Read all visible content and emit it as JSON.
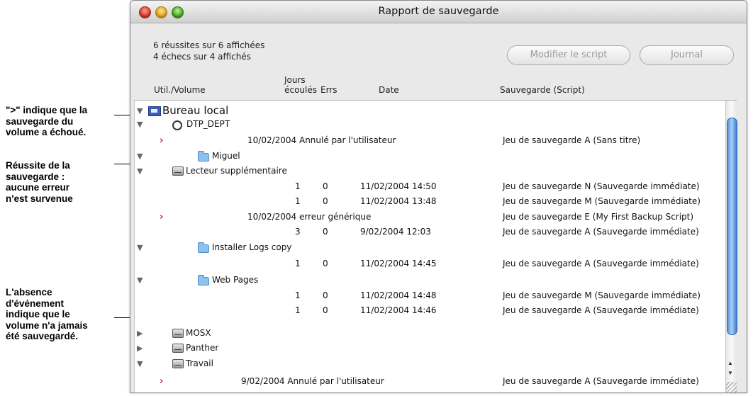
{
  "window": {
    "title": "Rapport de sauvegarde",
    "success_stat": "6 réussites sur 6 affichées",
    "failure_stat": "4 échecs sur 4 affichés",
    "edit_script_button": "Modifier le script",
    "log_button": "Journal"
  },
  "columns": {
    "user_volume": "Util./Volume",
    "days_line1": "Jours",
    "days_line2": "écoulés",
    "errors": "Errs",
    "date": "Date",
    "backup": "Sauvegarde (Script)"
  },
  "rows": [
    {
      "name": "Bureau local"
    },
    {
      "name": "DTP_DEPT"
    },
    {
      "marker": "›",
      "date_text": "10/02/2004 Annulé par l'utilisateur",
      "backup": "Jeu de sauvegarde A (Sans titre)"
    },
    {
      "name": "Miguel"
    },
    {
      "name": "Lecteur supplémentaire"
    },
    {
      "days": "1",
      "errs": "0",
      "date": "11/02/2004 14:50",
      "backup": "Jeu de sauvegarde N (Sauvegarde immédiate)"
    },
    {
      "days": "1",
      "errs": "0",
      "date": "11/02/2004 13:48",
      "backup": "Jeu de sauvegarde M (Sauvegarde immédiate)"
    },
    {
      "marker": "›",
      "date_text": "10/02/2004 erreur générique",
      "backup": "Jeu de sauvegarde E (My First Backup Script)"
    },
    {
      "days": "3",
      "errs": "0",
      "date": "9/02/2004 12:03",
      "backup": "Jeu de sauvegarde A (Sauvegarde immédiate)"
    },
    {
      "name": "Installer Logs copy"
    },
    {
      "days": "1",
      "errs": "0",
      "date": "11/02/2004 14:45",
      "backup": "Jeu de sauvegarde A (Sauvegarde immédiate)"
    },
    {
      "name": "Web Pages"
    },
    {
      "days": "1",
      "errs": "0",
      "date": "11/02/2004 14:48",
      "backup": "Jeu de sauvegarde M (Sauvegarde immédiate)"
    },
    {
      "days": "1",
      "errs": "0",
      "date": "11/02/2004 14:46",
      "backup": "Jeu de sauvegarde A (Sauvegarde immédiate)"
    },
    {
      "name": "MOSX"
    },
    {
      "name": "Panther"
    },
    {
      "name": "Travail"
    },
    {
      "marker": "›",
      "date_text": "9/02/2004 Annulé par l'utilisateur",
      "backup": "Jeu de sauvegarde A (Sauvegarde immédiate)"
    }
  ],
  "tree_icons": {
    "expanded": "▼",
    "collapsed": "▶"
  },
  "callouts": {
    "failed": [
      "\">\" indique que la",
      "sauvegarde du",
      "volume a échoué."
    ],
    "success": [
      "Réussite de la",
      "sauvegarde :",
      "aucune erreur",
      "n'est survenue"
    ],
    "never": [
      "L'absence",
      "d'événement",
      "indique que le",
      "volume n'a jamais",
      "été sauvegardé."
    ]
  }
}
